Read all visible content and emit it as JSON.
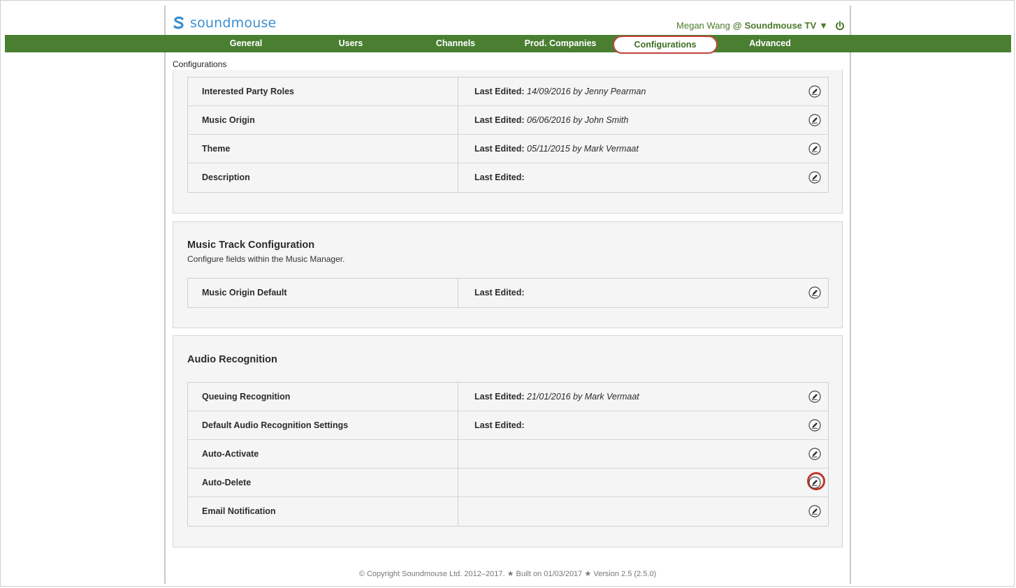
{
  "brand": {
    "name": "soundmouse",
    "color": "#3b8fd0"
  },
  "user": {
    "name": "Megan Wang",
    "at": "@",
    "org": "Soundmouse TV",
    "dropdown": "▼"
  },
  "nav": {
    "tabs": [
      {
        "label": "General"
      },
      {
        "label": "Users"
      },
      {
        "label": "Channels"
      },
      {
        "label": "Prod. Companies"
      },
      {
        "label": "Configurations",
        "active": true
      },
      {
        "label": "Advanced"
      }
    ],
    "accent": "#4a7f32"
  },
  "breadcrumb": "Configurations",
  "top_panel": {
    "rows": [
      {
        "name": "Interested Party Roles",
        "edited_label": "Last Edited:",
        "edited_value": "14/09/2016 by Jenny Pearman"
      },
      {
        "name": "Music Origin",
        "edited_label": "Last Edited:",
        "edited_value": "06/06/2016 by John Smith"
      },
      {
        "name": "Theme",
        "edited_label": "Last Edited:",
        "edited_value": "05/11/2015 by Mark Vermaat"
      },
      {
        "name": "Description",
        "edited_label": "Last Edited:",
        "edited_value": ""
      }
    ]
  },
  "music_track_panel": {
    "title": "Music Track Configuration",
    "subtitle": "Configure fields within the Music Manager.",
    "rows": [
      {
        "name": "Music Origin Default",
        "edited_label": "Last Edited:",
        "edited_value": ""
      }
    ]
  },
  "audio_panel": {
    "title": "Audio Recognition",
    "rows": [
      {
        "name": "Queuing Recognition",
        "edited_label": "Last Edited:",
        "edited_value": "21/01/2016 by Mark Vermaat"
      },
      {
        "name": "Default Audio Recognition Settings",
        "edited_label": "Last Edited:",
        "edited_value": ""
      },
      {
        "name": "Auto-Activate",
        "edited_label": "",
        "edited_value": ""
      },
      {
        "name": "Auto-Delete",
        "edited_label": "",
        "edited_value": "",
        "highlighted": true
      },
      {
        "name": "Email Notification",
        "edited_label": "",
        "edited_value": ""
      }
    ]
  },
  "footer": "© Copyright Soundmouse Ltd. 2012–2017. ★ Built on 01/03/2017 ★ Version 2.5 (2.5.0)",
  "highlight_color": "#c0392b"
}
